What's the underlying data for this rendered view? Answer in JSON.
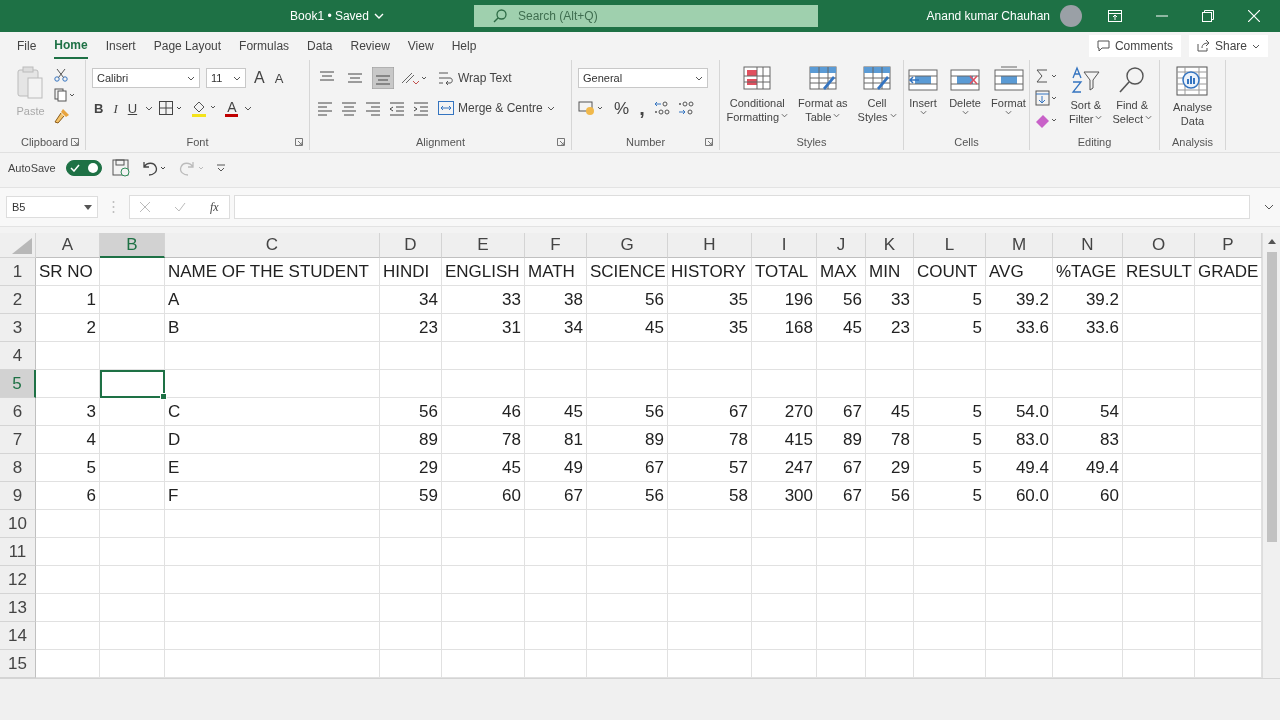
{
  "title_bar": {
    "document": "Book1 • Saved",
    "search_placeholder": "Search (Alt+Q)",
    "user": "Anand kumar Chauhan"
  },
  "menu_tabs": [
    {
      "label": "File",
      "selected": false
    },
    {
      "label": "Home",
      "selected": true
    },
    {
      "label": "Insert",
      "selected": false
    },
    {
      "label": "Page Layout",
      "selected": false
    },
    {
      "label": "Formulas",
      "selected": false
    },
    {
      "label": "Data",
      "selected": false
    },
    {
      "label": "Review",
      "selected": false
    },
    {
      "label": "View",
      "selected": false
    },
    {
      "label": "Help",
      "selected": false
    }
  ],
  "comments": "Comments",
  "share": "Share",
  "ribbon": {
    "clipboard": {
      "paste": "Paste",
      "label": "Clipboard"
    },
    "font": {
      "name": "Calibri",
      "size": "11",
      "grow": "A",
      "shrink": "A",
      "bold": "B",
      "italic": "I",
      "underline": "U",
      "color_letter": "A",
      "label": "Font"
    },
    "alignment": {
      "vertical": [
        {
          "selected": false
        },
        {
          "selected": false
        },
        {
          "selected": true
        }
      ],
      "wrap_text": "Wrap Text",
      "merge": "Merge & Centre",
      "label": "Alignment"
    },
    "number": {
      "format": "General",
      "percent": "%",
      "comma": ",",
      "label": "Number"
    },
    "styles": {
      "buttons": [
        {
          "lines": [
            "Conditional",
            "Formatting"
          ]
        },
        {
          "lines": [
            "Format as",
            "Table"
          ]
        },
        {
          "lines": [
            "Cell",
            "Styles"
          ]
        }
      ],
      "label": "Styles"
    },
    "cells": {
      "buttons": [
        "Insert",
        "Delete",
        "Format"
      ],
      "label": "Cells"
    },
    "editing": {
      "buttons": [
        {
          "lines": [
            "Sort &",
            "Filter"
          ]
        },
        {
          "lines": [
            "Find &",
            "Select"
          ]
        }
      ],
      "label": "Editing"
    },
    "analysis": {
      "lines": [
        "Analyse",
        "Data"
      ],
      "label": "Analysis"
    }
  },
  "quick_access": {
    "autosave_label": "AutoSave",
    "autosave_on": true
  },
  "formula_bar": {
    "name_box": "B5",
    "fx": "fx"
  },
  "sheet": {
    "columns": [
      {
        "label": "A",
        "selected": false,
        "numeric": true
      },
      {
        "label": "B",
        "selected": true
      },
      {
        "label": "C",
        "selected": false,
        "numeric": false
      },
      {
        "label": "D",
        "selected": false,
        "numeric": true
      },
      {
        "label": "E",
        "selected": false,
        "numeric": true
      },
      {
        "label": "F",
        "selected": false,
        "numeric": true
      },
      {
        "label": "G",
        "selected": false,
        "numeric": true
      },
      {
        "label": "H",
        "selected": false,
        "numeric": true
      },
      {
        "label": "I",
        "selected": false,
        "numeric": true
      },
      {
        "label": "J",
        "selected": false,
        "numeric": true
      },
      {
        "label": "K",
        "selected": false,
        "numeric": true
      },
      {
        "label": "L",
        "selected": false,
        "numeric": true
      },
      {
        "label": "M",
        "selected": false,
        "numeric": true
      },
      {
        "label": "N",
        "selected": false,
        "numeric": true
      },
      {
        "label": "O",
        "selected": false
      },
      {
        "label": "P",
        "selected": false
      }
    ],
    "rows": [
      {
        "number": "1",
        "selected": false,
        "kind": "header",
        "cells": [
          "SR NO",
          null,
          "NAME OF THE STUDENT",
          "HINDI",
          "ENGLISH",
          "MATH",
          "SCIENCE",
          "HISTORY",
          "TOTAL",
          "MAX",
          "MIN",
          "COUNT",
          "AVG",
          "%TAGE",
          "RESULT",
          "GRADE"
        ]
      },
      {
        "number": "2",
        "selected": false,
        "kind": "data",
        "cells": [
          "1",
          null,
          "A",
          "34",
          "33",
          "38",
          "56",
          "35",
          "196",
          "56",
          "33",
          "5",
          "39.2",
          "39.2",
          null,
          null
        ]
      },
      {
        "number": "3",
        "selected": false,
        "kind": "data",
        "cells": [
          "2",
          null,
          "B",
          "23",
          "31",
          "34",
          "45",
          "35",
          "168",
          "45",
          "23",
          "5",
          "33.6",
          "33.6",
          null,
          null
        ]
      },
      {
        "number": "4",
        "selected": false
      },
      {
        "number": "5",
        "selected": true
      },
      {
        "number": "6",
        "selected": false,
        "kind": "data",
        "cells": [
          "3",
          null,
          "C",
          "56",
          "46",
          "45",
          "56",
          "67",
          "270",
          "67",
          "45",
          "5",
          "54.0",
          "54",
          null,
          null
        ]
      },
      {
        "number": "7",
        "selected": false,
        "kind": "data",
        "cells": [
          "4",
          null,
          "D",
          "89",
          "78",
          "81",
          "89",
          "78",
          "415",
          "89",
          "78",
          "5",
          "83.0",
          "83",
          null,
          null
        ]
      },
      {
        "number": "8",
        "selected": false,
        "kind": "data",
        "cells": [
          "5",
          null,
          "E",
          "29",
          "45",
          "49",
          "67",
          "57",
          "247",
          "67",
          "29",
          "5",
          "49.4",
          "49.4",
          null,
          null
        ]
      },
      {
        "number": "9",
        "selected": false,
        "kind": "data",
        "cells": [
          "6",
          null,
          "F",
          "59",
          "60",
          "67",
          "56",
          "58",
          "300",
          "67",
          "56",
          "5",
          "60.0",
          "60",
          null,
          null
        ]
      },
      {
        "number": "10",
        "selected": false
      },
      {
        "number": "11",
        "selected": false
      },
      {
        "number": "12",
        "selected": false
      },
      {
        "number": "13",
        "selected": false
      },
      {
        "number": "14",
        "selected": false
      },
      {
        "number": "15",
        "selected": false
      }
    ]
  }
}
